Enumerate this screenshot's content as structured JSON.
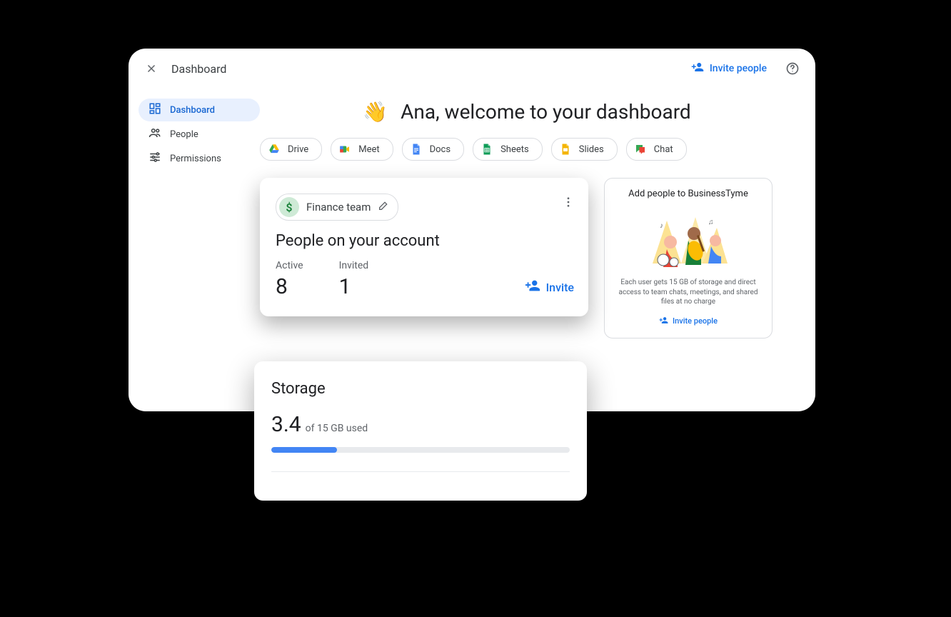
{
  "header": {
    "breadcrumb": "Dashboard",
    "invite_label": "Invite people"
  },
  "sidebar": {
    "items": [
      {
        "label": "Dashboard"
      },
      {
        "label": "People"
      },
      {
        "label": "Permissions"
      }
    ]
  },
  "welcome": {
    "emoji": "👋",
    "text": "Ana, welcome to your dashboard"
  },
  "apps": [
    {
      "label": "Drive"
    },
    {
      "label": "Meet"
    },
    {
      "label": "Docs"
    },
    {
      "label": "Sheets"
    },
    {
      "label": "Slides"
    },
    {
      "label": "Chat"
    }
  ],
  "people_card": {
    "team_name": "Finance team",
    "team_symbol": "$",
    "title": "People on your account",
    "active_label": "Active",
    "active_value": "8",
    "invited_label": "Invited",
    "invited_value": "1",
    "invite_label": "Invite"
  },
  "promo_card": {
    "title": "Add people to BusinessTyme",
    "description": "Each user gets 15 GB of storage and direct access to team chats, meetings, and shared files at no charge",
    "link_label": "Invite people"
  },
  "storage_card": {
    "title": "Storage",
    "value": "3.4",
    "suffix": "of 15 GB used",
    "percent": 22
  },
  "colors": {
    "blue": "#1a73e8",
    "green": "#34a853",
    "yellow": "#fbbc04",
    "red": "#ea4335"
  }
}
